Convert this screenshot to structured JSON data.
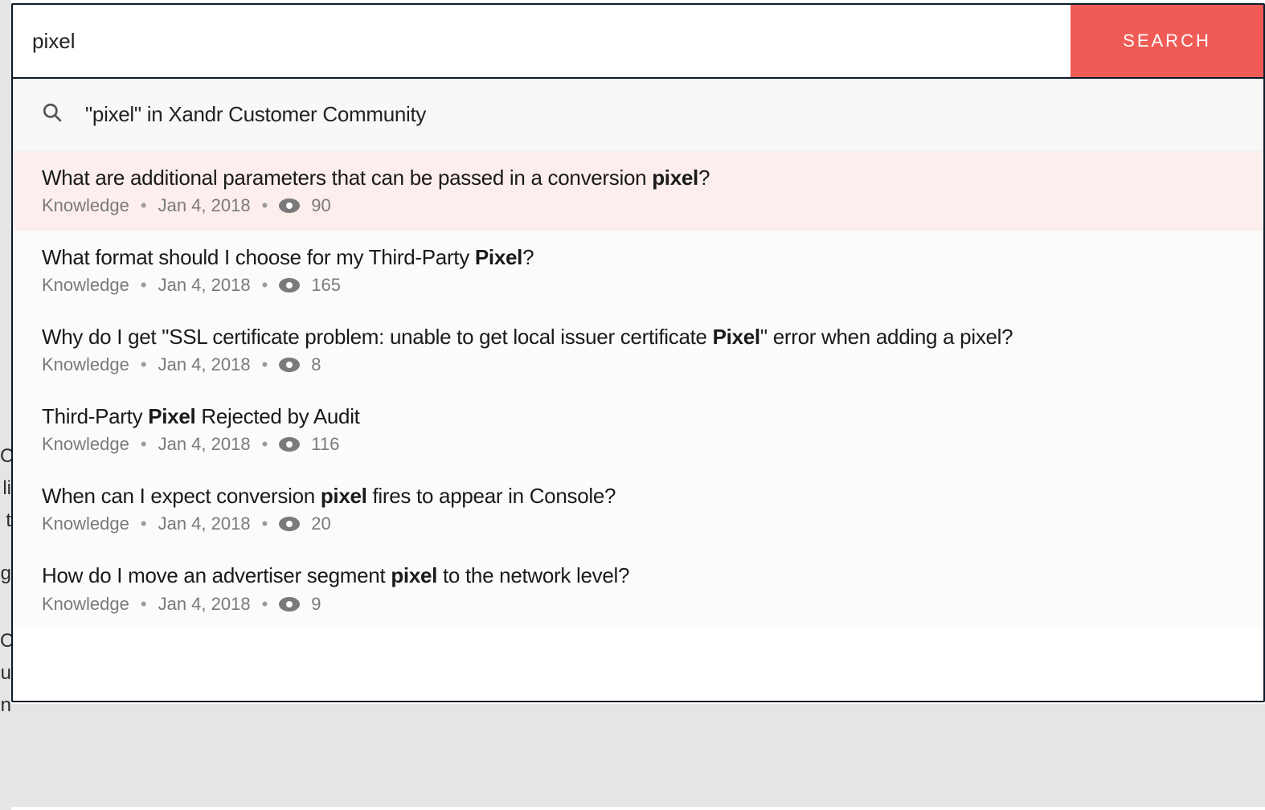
{
  "search": {
    "value": "pixel",
    "button_label": "SEARCH",
    "scope_text": "\"pixel\" in Xandr Customer Community"
  },
  "results": [
    {
      "title_parts": [
        "What are additional parameters that can be passed in a conversion ",
        "pixel",
        "?"
      ],
      "category": "Knowledge",
      "date": "Jan 4, 2018",
      "views": "90",
      "highlight": true
    },
    {
      "title_parts": [
        "What format should I choose for my Third-Party ",
        "Pixel",
        "?"
      ],
      "category": "Knowledge",
      "date": "Jan 4, 2018",
      "views": "165",
      "highlight": false
    },
    {
      "title_parts": [
        "Why do I get \"SSL certificate problem: unable to get local issuer certificate ",
        "Pixel",
        "\" error when adding a pixel?"
      ],
      "category": "Knowledge",
      "date": "Jan 4, 2018",
      "views": "8",
      "highlight": false
    },
    {
      "title_parts": [
        "Third-Party ",
        "Pixel",
        " Rejected by Audit"
      ],
      "category": "Knowledge",
      "date": "Jan 4, 2018",
      "views": "116",
      "highlight": false
    },
    {
      "title_parts": [
        "When can I expect conversion ",
        "pixel",
        " fires to appear in Console?"
      ],
      "category": "Knowledge",
      "date": "Jan 4, 2018",
      "views": "20",
      "highlight": false
    },
    {
      "title_parts": [
        "How do I move an advertiser segment ",
        "pixel",
        " to the network level?"
      ],
      "category": "Knowledge",
      "date": "Jan 4, 2018",
      "views": "9",
      "highlight": false
    }
  ],
  "underlay_glyphs": [
    "C",
    "li",
    "t",
    "g",
    "C",
    "u",
    "n"
  ]
}
